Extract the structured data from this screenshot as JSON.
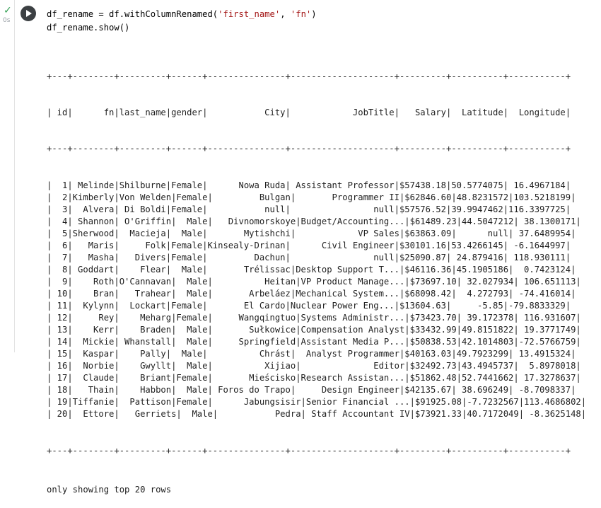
{
  "gutter": {
    "check": "✓",
    "exec_time": "0s"
  },
  "code": {
    "line1_prefix": "df_rename = df.withColumnRenamed(",
    "arg1": "'first_name'",
    "sep": ", ",
    "arg2": "'fn'",
    "line1_suffix": ")",
    "line2": "df_rename.show()"
  },
  "table": {
    "border": "+---+--------+---------+------+---------------+--------------------+---------+----------+-----------+",
    "header": "| id|      fn|last_name|gender|           City|            JobTitle|   Salary|  Latitude|  Longitude|",
    "rows": [
      "|  1| Melinde|Shilburne|Female|      Nowa Ruda| Assistant Professor|$57438.18|50.5774075| 16.4967184|",
      "|  2|Kimberly|Von Welden|Female|         Bulgan|       Programmer II|$62846.60|48.8231572|103.5218199|",
      "|  3|  Alvera| Di Boldi|Female|           null|                null|$57576.52|39.9947462|116.3397725|",
      "|  4| Shannon| O'Griffin|  Male|   Divnomorskoye|Budget/Accounting...|$61489.23|44.5047212| 38.1300171|",
      "|  5|Sherwood|  Macieja|  Male|       Mytishchi|            VP Sales|$63863.09|      null| 37.6489954|",
      "|  6|   Maris|     Folk|Female|Kinsealy-Drinan|      Civil Engineer|$30101.16|53.4266145| -6.1644997|",
      "|  7|   Masha|   Divers|Female|         Dachun|                null|$25090.87| 24.879416| 118.930111|",
      "|  8| Goddart|    Flear|  Male|       Trélissac|Desktop Support T...|$46116.36|45.1905186|  0.7423124|",
      "|  9|    Roth|O'Cannavan|  Male|          Heitan|VP Product Manage...|$73697.10| 32.027934| 106.651113|",
      "| 10|    Bran|   Trahear|  Male|       Arbeláez|Mechanical System...|$68098.42|  4.272793| -74.416014|",
      "| 11|  Kylynn|  Lockart|Female|       El Cardo|Nuclear Power Eng...|$13604.63|     -5.85|-79.8833329|",
      "| 12|     Rey|    Meharg|Female|     Wangqingtuo|Systems Administr...|$73423.70| 39.172378| 116.931607|",
      "| 13|    Kerr|    Braden|  Male|       Sułkowice|Compensation Analyst|$33432.99|49.8151822| 19.3771749|",
      "| 14|  Mickie| Whanstall|  Male|     Springfield|Assistant Media P...|$50838.53|42.1014803|-72.5766759|",
      "| 15|  Kaspar|    Pally|  Male|          Chrást|  Analyst Programmer|$40163.03|49.7923299| 13.4915324|",
      "| 16|  Norbie|    Gwyllt|  Male|          Xijiao|              Editor|$32492.73|43.4945737|  5.8978018|",
      "| 17|  Claude|    Briant|Female|       Mieścisko|Research Assistan...|$51862.48|52.7441662| 17.3278637|",
      "| 18|   Thain|    Habbon|  Male| Foros do Trapo|     Design Engineer|$42135.67| 38.696249| -8.7098337|",
      "| 19|Tiffanie|  Pattison|Female|      Jabungsisir|Senior Financial ...|$91925.08|-7.7232567|113.4686802|",
      "| 20|  Ettore|   Gerriets|  Male|           Pedra| Staff Accountant IV|$73921.33|40.7172049| -8.3625148|"
    ],
    "footer": "only showing top 20 rows"
  }
}
